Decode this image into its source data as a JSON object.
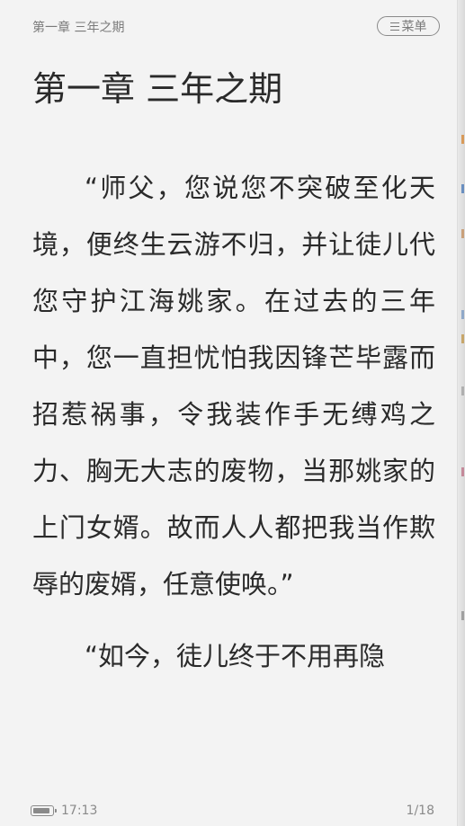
{
  "header": {
    "title": "第一章 三年之期",
    "menu_label": "菜单",
    "menu_icon": "hamburger-menu-icon"
  },
  "chapter": {
    "title": "第一章 三年之期",
    "paragraphs": [
      "“师父，您说您不突破至化天境，便终生云游不归，并让徒儿代您守护江海姚家。在过去的三年中，您一直担忧怕我因锋芒毕露而招惹祸事，令我装作手无缚鸡之力、胸无大志的废物，当那姚家的上门女婿。故而人人都把我当作欺辱的废婿，任意使唤。”",
      "“如今，徒儿终于不用再隐"
    ]
  },
  "footer": {
    "time": "17:13",
    "battery_icon": "battery-icon",
    "page": "1/18"
  }
}
